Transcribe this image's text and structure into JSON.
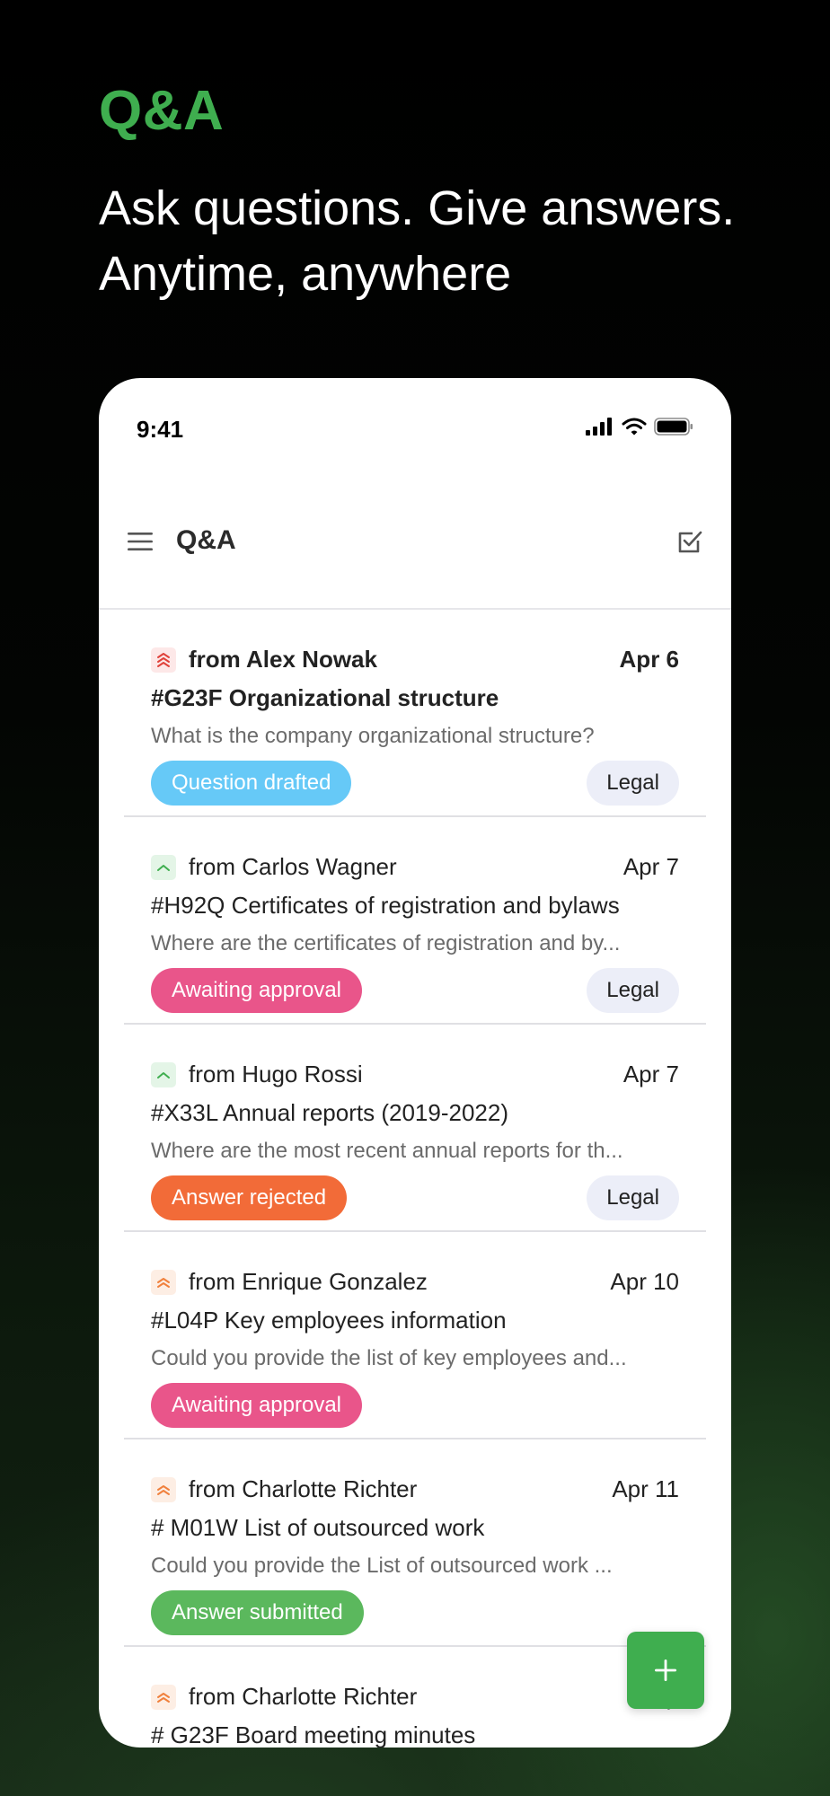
{
  "hero": {
    "title": "Q&A",
    "tagline": "Ask questions. Give answers. Anytime, anywhere"
  },
  "status_bar": {
    "time": "9:41",
    "icons": [
      "signal-icon",
      "wifi-icon",
      "battery-icon"
    ]
  },
  "app_bar": {
    "title": "Q&A",
    "menu_icon": "menu-icon",
    "action_icon": "checkbox-icon"
  },
  "colors": {
    "accent": "#3fae4f",
    "status_question_drafted": "#66c9f7",
    "status_awaiting_approval": "#e9558a",
    "status_answer_rejected": "#f26b38",
    "status_answer_submitted": "#5bb85d",
    "priority_high": "#e0413a",
    "priority_low": "#3fae4f",
    "priority_medium": "#f0803c"
  },
  "questions": [
    {
      "priority": "high",
      "from": "from Alex Nowak",
      "date": "Apr 6",
      "subject": "#G23F Organizational structure",
      "question": "What is the company organizational structure?",
      "status": "Question drafted",
      "status_color": "#66c9f7",
      "tag": "Legal",
      "unread": true
    },
    {
      "priority": "low",
      "from": "from Carlos Wagner",
      "date": "Apr 7",
      "subject": "#H92Q Certificates of registration and bylaws",
      "question": "Where are the certificates of registration and by...",
      "status": "Awaiting approval",
      "status_color": "#e9558a",
      "tag": "Legal",
      "unread": false
    },
    {
      "priority": "low",
      "from": "from Hugo Rossi",
      "date": "Apr 7",
      "subject": "#X33L Annual reports (2019-2022)",
      "question": "Where are the most recent annual reports for th...",
      "status": "Answer rejected",
      "status_color": "#f26b38",
      "tag": "Legal",
      "unread": false
    },
    {
      "priority": "medium",
      "from": "from Enrique Gonzalez",
      "date": "Apr 10",
      "subject": "#L04P Key employees information",
      "question": "Could you provide the list of key employees and...",
      "status": "Awaiting approval",
      "status_color": "#e9558a",
      "tag": "",
      "unread": false
    },
    {
      "priority": "medium",
      "from": "from Charlotte Richter",
      "date": "Apr 11",
      "subject": "# M01W List of outsourced work",
      "question": "Could you provide the List of outsourced work ...",
      "status": "Answer submitted",
      "status_color": "#5bb85d",
      "tag": "",
      "unread": false
    },
    {
      "priority": "medium",
      "from": "from Charlotte Richter",
      "date": "Ap",
      "subject": "# G23F Board meeting minutes",
      "question": "",
      "status": "",
      "status_color": "",
      "tag": "",
      "unread": false
    }
  ],
  "fab": {
    "label": "+"
  }
}
